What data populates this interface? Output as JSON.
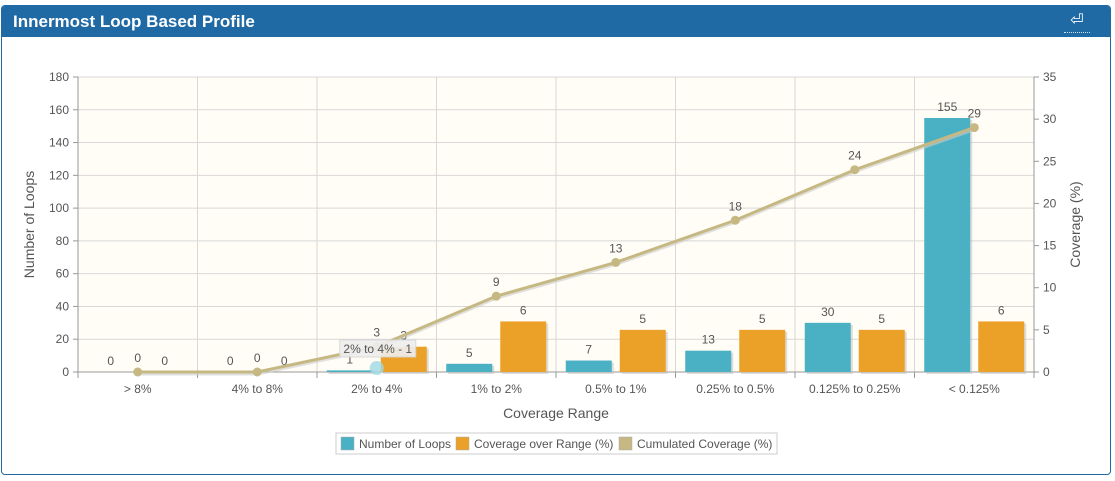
{
  "panel": {
    "title": "Innermost Loop Based Profile",
    "return_icon": "return-arrow-icon",
    "return_glyph": "⏎"
  },
  "colors": {
    "header_bg": "#1f6aa5",
    "loops": "#4ab0c4",
    "coverage": "#eba127",
    "cumulated": "#c6b882",
    "plot_bg": "#fffdf5"
  },
  "chart_data": {
    "type": "bar",
    "xlabel": "Coverage Range",
    "ylabel": "Number of Loops",
    "y2label": "Coverage (%)",
    "categories": [
      "> 8%",
      "4% to 8%",
      "2% to 4%",
      "1% to 2%",
      "0.5% to 1%",
      "0.25% to 0.5%",
      "0.125% to 0.25%",
      "< 0.125%"
    ],
    "ylim": [
      0,
      180
    ],
    "yticks": [
      0,
      20,
      40,
      60,
      80,
      100,
      120,
      140,
      160,
      180
    ],
    "y2lim": [
      0,
      35
    ],
    "y2ticks": [
      0,
      5,
      10,
      15,
      20,
      25,
      30,
      35
    ],
    "grid": true,
    "legend_position": "bottom",
    "series": [
      {
        "name": "Number of Loops",
        "type": "bar",
        "axis": "left",
        "values": [
          0,
          0,
          1,
          5,
          7,
          13,
          30,
          155
        ]
      },
      {
        "name": "Coverage over Range (%)",
        "type": "bar",
        "axis": "right",
        "values": [
          0,
          0,
          3,
          6,
          5,
          5,
          5,
          6
        ]
      },
      {
        "name": "Cumulated Coverage (%)",
        "type": "line",
        "axis": "right",
        "values": [
          0,
          0,
          3,
          9,
          13,
          18,
          24,
          29
        ]
      }
    ],
    "tooltip": {
      "text": "2% to 4% - 1",
      "category_index": 2
    }
  }
}
